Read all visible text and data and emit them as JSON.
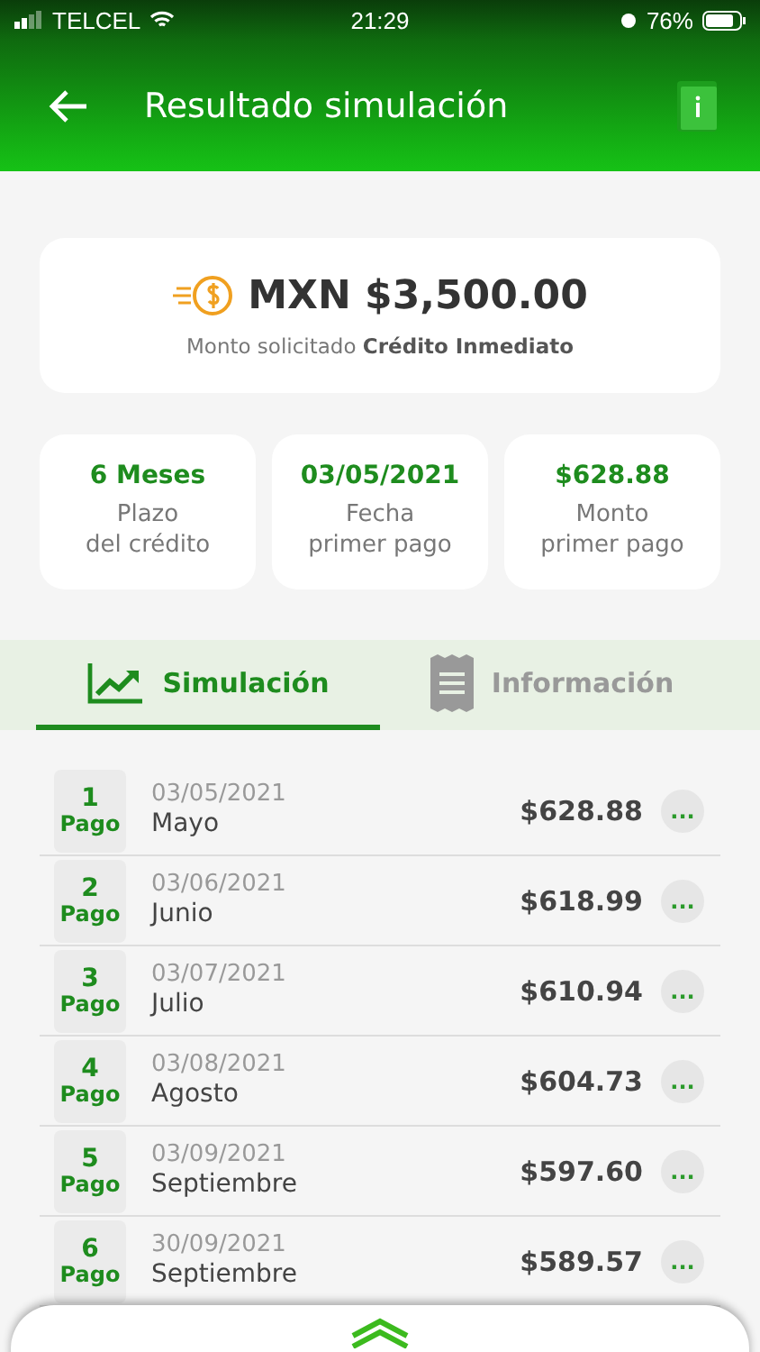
{
  "status_bar": {
    "carrier": "TELCEL",
    "time": "21:29",
    "battery": "76%"
  },
  "header": {
    "title": "Resultado simulación"
  },
  "amount": {
    "value": "MXN $3,500.00",
    "caption": "Monto solicitado **Crédito Inmediato**"
  },
  "summary": [
    {
      "value": "6 Meses",
      "label": "Plazo\ndel crédito"
    },
    {
      "value": "03/05/2021",
      "label": "Fecha\nprimer pago"
    },
    {
      "value": "$628.88",
      "label": "Monto\nprimer pago"
    }
  ],
  "tabs": [
    {
      "label": "Simulación",
      "kind": "chart",
      "selected": true
    },
    {
      "label": "Información",
      "kind": "receipt",
      "selected": false
    }
  ],
  "payments": [
    {
      "number": "1",
      "unit": "Pago",
      "date": "03/05/2021",
      "month": "Mayo",
      "amount": "$628.88",
      "more": "..."
    },
    {
      "number": "2",
      "unit": "Pago",
      "date": "03/06/2021",
      "month": "Junio",
      "amount": "$618.99",
      "more": "..."
    },
    {
      "number": "3",
      "unit": "Pago",
      "date": "03/07/2021",
      "month": "Julio",
      "amount": "$610.94",
      "more": "..."
    },
    {
      "number": "4",
      "unit": "Pago",
      "date": "03/08/2021",
      "month": "Agosto",
      "amount": "$604.73",
      "more": "..."
    },
    {
      "number": "5",
      "unit": "Pago",
      "date": "03/09/2021",
      "month": "Septiembre",
      "amount": "$597.60",
      "more": "..."
    },
    {
      "number": "6",
      "unit": "Pago",
      "date": "30/09/2021",
      "month": "Septiembre",
      "amount": "$589.57",
      "more": "..."
    }
  ]
}
